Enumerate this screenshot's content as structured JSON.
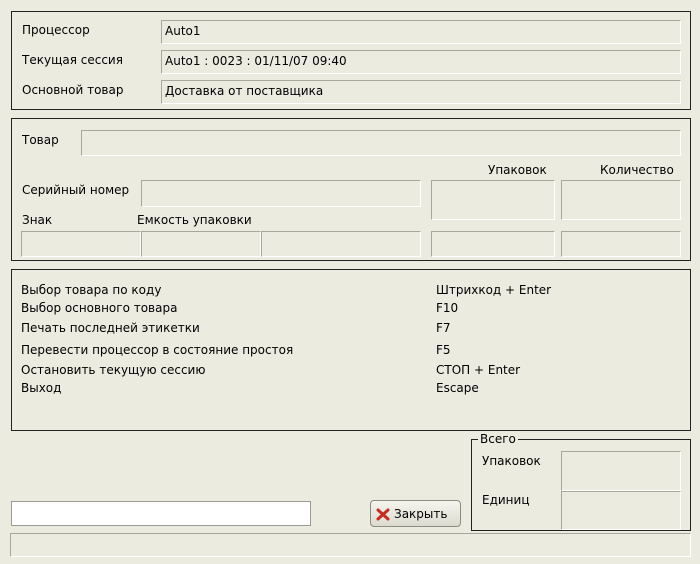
{
  "session": {
    "processor_label": "Процессор",
    "processor_value": "Auto1",
    "current_session_label": "Текущая сессия",
    "current_session_value": "Auto1 : 0023 : 01/11/07 09:40",
    "main_product_label": "Основной товар",
    "main_product_value": "Доставка от поставщика"
  },
  "item": {
    "product_label": "Товар",
    "product_value": "",
    "packs_header": "Упаковок",
    "quantity_header": "Количество",
    "serial_label": "Серийный номер",
    "sign_label": "Знак",
    "capacity_label": "Емкость упаковки"
  },
  "shortcuts": [
    {
      "action": "Выбор товара по коду",
      "key": "Штрихкод + Enter"
    },
    {
      "action": "Выбор основного товара",
      "key": "F10"
    },
    {
      "action": "Печать последней этикетки",
      "key": "F7"
    },
    {
      "action": "Перевести процессор в состояние простоя",
      "key": "F5"
    },
    {
      "action": "Остановить текущую сессию",
      "key": "СТОП + Enter"
    },
    {
      "action": "Выход",
      "key": "Escape"
    }
  ],
  "totals": {
    "title": "Всего",
    "packs_label": "Упаковок",
    "units_label": "Единиц"
  },
  "footer": {
    "input_value": "",
    "close_button_label": "Закрыть",
    "close_icon": "red-x-icon",
    "status_text": ""
  }
}
